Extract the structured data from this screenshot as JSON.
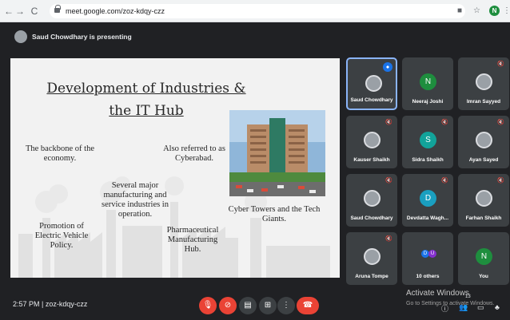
{
  "browser": {
    "back": "←",
    "forward": "→",
    "reload": "C",
    "url": "meet.google.com/zoz-kdqy-czz",
    "profile_initial": "N"
  },
  "presenter_bar": {
    "text": "Saud Chowdhary is presenting"
  },
  "slide": {
    "title_line1": "Development of Industries &",
    "title_line2": "the  IT Hub",
    "points": {
      "backbone": "The backbone of the economy.",
      "cyberabad": "Also referred to as Cyberabad.",
      "several": "Several major manufacturing and service industries in operation.",
      "towers": "Cyber Towers and the Tech Giants.",
      "ev": "Promotion of Electric Vehicle Policy.",
      "pharma": "Pharmaceutical Manufacturing Hub."
    }
  },
  "participants": [
    {
      "name": "Saud Chowdhary",
      "kind": "photo",
      "active": true,
      "speaking": true
    },
    {
      "name": "Neeraj Joshi",
      "kind": "initial",
      "initial": "N",
      "color": "#1e8e3e"
    },
    {
      "name": "Imran Sayyed",
      "kind": "photo"
    },
    {
      "name": "Kauser Shaikh",
      "kind": "photo"
    },
    {
      "name": "Sidra Shaikh",
      "kind": "initial",
      "initial": "S",
      "color": "#12a39a"
    },
    {
      "name": "Ayan Sayed",
      "kind": "photo"
    },
    {
      "name": "Saud Chowdhary",
      "kind": "photo"
    },
    {
      "name": "Devdatta Wagh...",
      "kind": "initial",
      "initial": "D",
      "color": "#1a9fc0"
    },
    {
      "name": "Farhan Shaikh",
      "kind": "photo"
    },
    {
      "name": "Aruna Tompe",
      "kind": "photo"
    },
    {
      "name": "10 others",
      "kind": "others",
      "mini": [
        "D",
        "U"
      ]
    },
    {
      "name": "You",
      "kind": "initial",
      "initial": "N",
      "color": "#1e8e3e"
    }
  ],
  "bottom": {
    "time_code": "2:57 PM  |  zoz-kdqy-czz",
    "activate_line1": "Activate Windows",
    "activate_line2": "Go to Settings to activate Windows.",
    "people_badge": "13"
  },
  "colors": {
    "meet_bg": "#202124",
    "tile_bg": "#3c4043",
    "accent": "#8ab4f8",
    "end_call": "#ea4335"
  },
  "icons": [
    "arrow-left-icon",
    "arrow-right-icon",
    "reload-icon",
    "lock-icon",
    "camera-icon",
    "star-icon",
    "menu-icon",
    "mic-off-icon",
    "cam-off-icon",
    "captions-icon",
    "present-icon",
    "more-icon",
    "end-call-icon",
    "info-icon",
    "people-icon",
    "chat-icon",
    "activities-icon"
  ]
}
